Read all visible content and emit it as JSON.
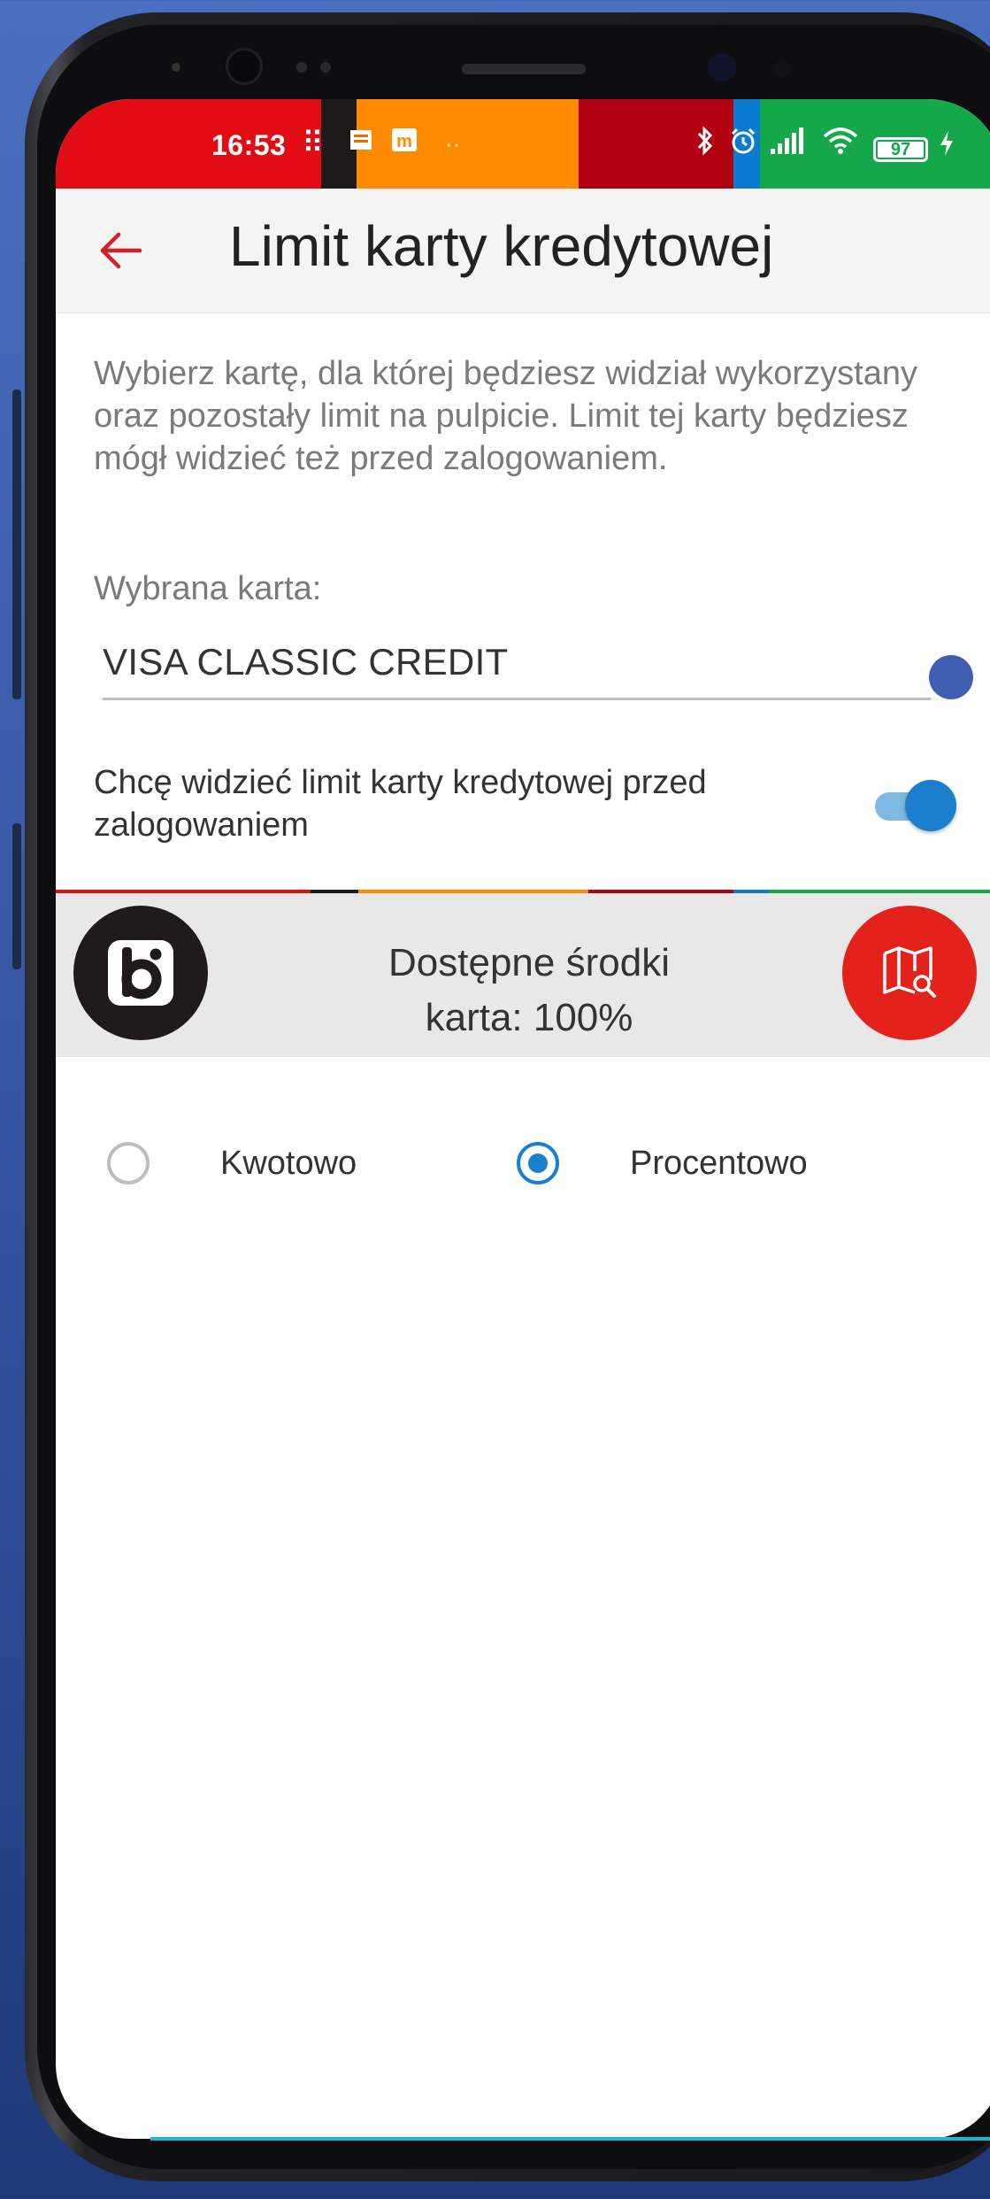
{
  "status_bar": {
    "time": "16:53",
    "battery": "97",
    "segment_colors": [
      "#e30b14",
      "#1d1a1a",
      "#ff8a00",
      "#b00012",
      "#0a7bd1",
      "#14a84a"
    ]
  },
  "header": {
    "title": "Limit karty kredytowej",
    "back_icon": "arrow-left-icon"
  },
  "description": "Wybierz kartę, dla której będziesz widział wykorzystany oraz pozostały limit na pulpicie. Limit tej karty będziesz mógł widzieć też przed zalogowaniem.",
  "card_select": {
    "label": "Wybrana karta:",
    "value": "VISA CLASSIC CREDIT"
  },
  "pre_login_toggle": {
    "label": "Chcę widzieć limit karty kredytowej przed zalogowaniem",
    "checked": true
  },
  "widget_preview": {
    "line1": "Dostępne środki",
    "line2": "karta: 100%",
    "logo_icon": "bank-logo-icon",
    "map_icon": "map-search-icon"
  },
  "display_mode": {
    "options": [
      {
        "label": "Kwotowo",
        "checked": false
      },
      {
        "label": "Procentowo",
        "checked": true
      }
    ]
  },
  "colors": {
    "accent_red": "#e3231b",
    "accent_blue": "#1a7fcf"
  }
}
